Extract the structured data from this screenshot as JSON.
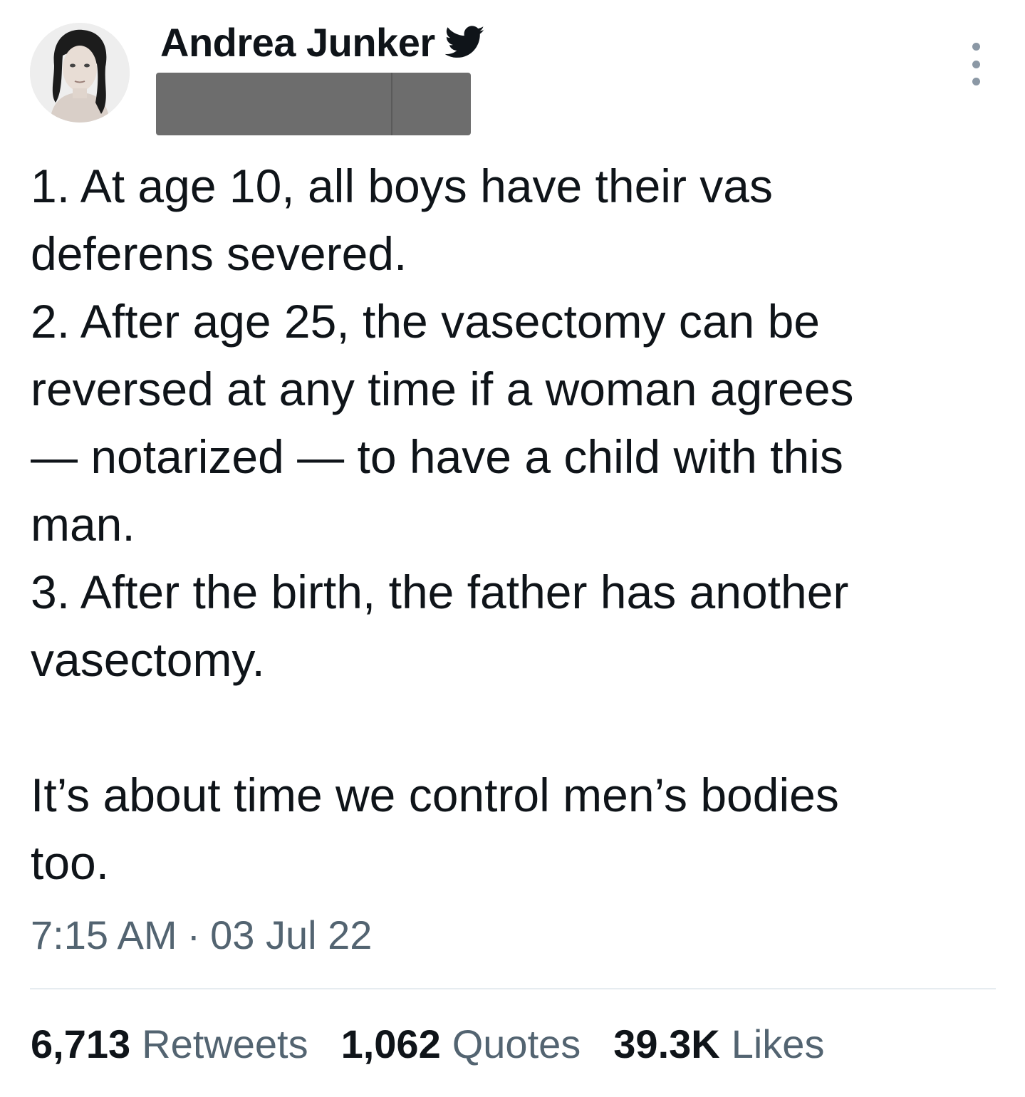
{
  "author": {
    "name": "Andrea Junker",
    "handle_redacted": true,
    "verified_icon": "twitter-bird-icon"
  },
  "tweet": {
    "lines": [
      "1. At age 10, all boys have their vas",
      "deferens severed.",
      "2. After age 25, the vasectomy can be",
      "reversed at any time if a woman agrees",
      "— notarized — to have a child with this",
      "man.",
      "3. After the birth, the father has another",
      "vasectomy.",
      "",
      "It’s about time we control men’s bodies",
      "too."
    ]
  },
  "meta": {
    "time": "7:15 AM",
    "separator": "·",
    "date": "03 Jul 22"
  },
  "stats": {
    "retweets": {
      "count": "6,713",
      "label": "Retweets"
    },
    "quotes": {
      "count": "1,062",
      "label": "Quotes"
    },
    "likes": {
      "count": "39.3K",
      "label": "Likes"
    }
  },
  "colors": {
    "text": "#0f1419",
    "secondary": "#536471",
    "divider": "#e6ecf0",
    "redaction": "#6d6d6d"
  }
}
